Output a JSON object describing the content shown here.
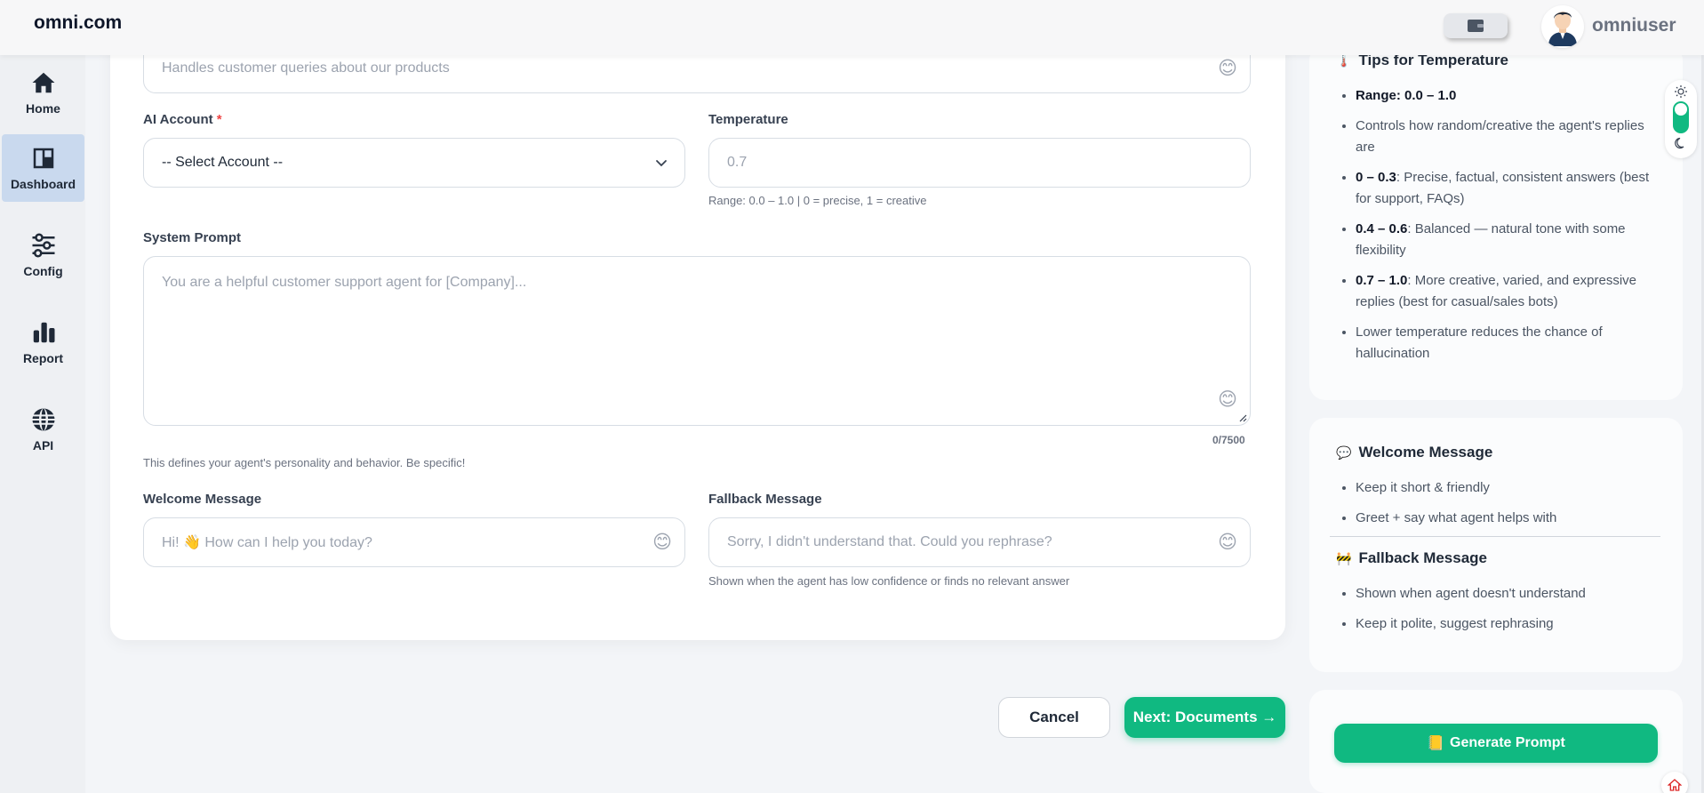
{
  "app": {
    "brand": "omni.com",
    "username": "omniuser"
  },
  "sidebar": {
    "items": [
      {
        "label": "Home",
        "icon": "home-icon"
      },
      {
        "label": "Dashboard",
        "icon": "dashboard-icon",
        "active": true
      },
      {
        "label": "Config",
        "icon": "sliders-icon"
      },
      {
        "label": "Report",
        "icon": "bar-chart-icon"
      },
      {
        "label": "API",
        "icon": "globe-icon"
      }
    ]
  },
  "form": {
    "description": {
      "placeholder": "Handles customer queries about our products"
    },
    "ai_account": {
      "label": "AI Account",
      "required_mark": "*",
      "value": "-- Select Account --"
    },
    "temperature": {
      "label": "Temperature",
      "placeholder": "0.7",
      "hint": "Range: 0.0 – 1.0 | 0 = precise, 1 = creative"
    },
    "system_prompt": {
      "label": "System Prompt",
      "placeholder": "You are a helpful customer support agent for [Company]...",
      "counter": "0/7500",
      "hint": "This defines your agent's personality and behavior. Be specific!"
    },
    "welcome": {
      "label": "Welcome Message",
      "placeholder": "Hi! 👋 How can I help you today?"
    },
    "fallback": {
      "label": "Fallback Message",
      "placeholder": "Sorry, I didn't understand that. Could you rephrase?",
      "hint": "Shown when the agent has low confidence or finds no relevant answer"
    },
    "emoji": "😊"
  },
  "actions": {
    "cancel": "Cancel",
    "next": "Next: Documents →"
  },
  "tips": {
    "temperature": {
      "title": "Tips for Temperature",
      "icon": "🌡️",
      "items": [
        {
          "bold": "Range: 0.0 – 1.0",
          "text": ""
        },
        {
          "bold": "",
          "text": "Controls how random/creative the agent's replies are"
        },
        {
          "bold": "0 – 0.3",
          "text": ": Precise, factual, consistent answers (best for support, FAQs)"
        },
        {
          "bold": "0.4 – 0.6",
          "text": ": Balanced — natural tone with some flexibility"
        },
        {
          "bold": "0.7 – 1.0",
          "text": ": More creative, varied, and expressive replies (best for casual/sales bots)"
        },
        {
          "bold": "",
          "text": "Lower temperature reduces the chance of hallucination"
        }
      ]
    },
    "welcome": {
      "title": "Welcome Message",
      "icon": "💬",
      "items": [
        "Keep it short & friendly",
        "Greet + say what agent helps with"
      ]
    },
    "fallback": {
      "title": "Fallback Message",
      "icon": "🚧",
      "items": [
        "Shown when agent doesn't understand",
        "Keep it polite, suggest rephrasing"
      ]
    },
    "generate_button": "Generate Prompt",
    "generate_icon": "📒"
  },
  "colors": {
    "accent": "#10b981",
    "active_nav": "#c9d9ee",
    "required": "#ef4444"
  }
}
